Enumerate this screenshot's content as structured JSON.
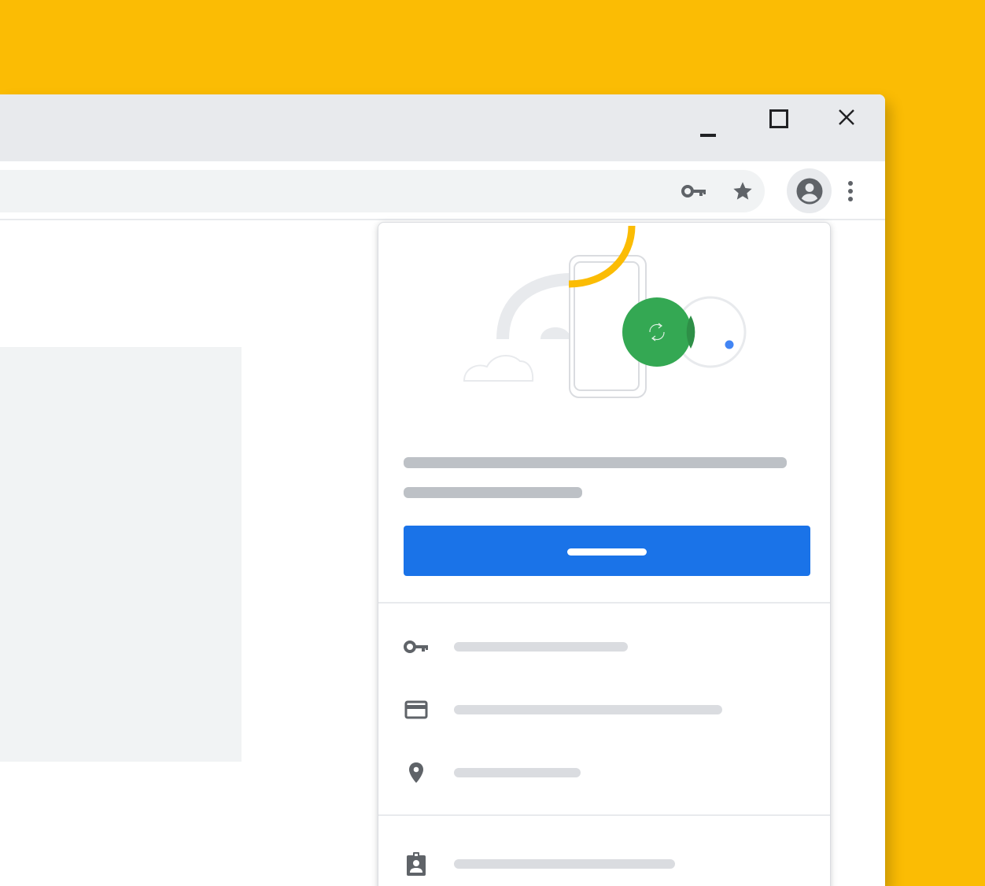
{
  "colors": {
    "background": "#fbbc04",
    "titlebar": "#e8eaed",
    "omnibox": "#f1f3f4",
    "icon": "#5f6368",
    "primary_button": "#1a73e8",
    "placeholder_dark": "#bdc1c6",
    "placeholder_light": "#dadce0",
    "sync_green": "#34a853",
    "accent_yellow": "#fbbc04",
    "accent_blue": "#4285f4"
  },
  "window_controls": {
    "minimize_icon": "minimize-icon",
    "maximize_icon": "maximize-icon",
    "close_icon": "close-icon"
  },
  "toolbar": {
    "omnibox_icons": [
      "key-icon",
      "star-icon"
    ],
    "profile_icon": "account-circle-icon",
    "menu_icon": "more-vert-icon"
  },
  "popup": {
    "illustration_icons": [
      "phone-icon",
      "sync-icon",
      "cloud-icon"
    ],
    "sync_button_label_placeholder": "",
    "menu_items": [
      {
        "icon": "key-icon",
        "label": ""
      },
      {
        "icon": "credit-card-icon",
        "label": ""
      },
      {
        "icon": "location-pin-icon",
        "label": ""
      },
      {
        "icon": "contact-badge-icon",
        "label": ""
      }
    ]
  }
}
